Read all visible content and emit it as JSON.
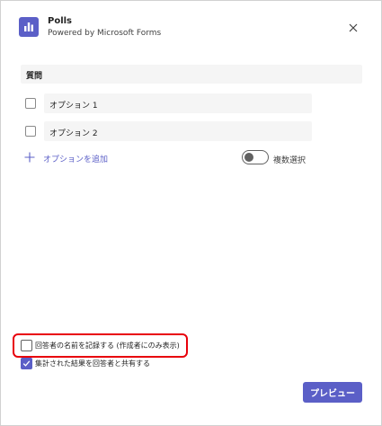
{
  "header": {
    "app_name": "Polls",
    "subtitle": "Powered by Microsoft Forms",
    "icon": "poll-chart-icon",
    "close_icon": "close-icon"
  },
  "question": {
    "placeholder": "質問"
  },
  "options": [
    {
      "label": "オプション 1",
      "checked": false
    },
    {
      "label": "オプション 2",
      "checked": false
    }
  ],
  "add_option": {
    "label": "オプションを追加",
    "icon": "plus-icon"
  },
  "multi_select": {
    "label": "複数選択",
    "enabled": false
  },
  "settings": {
    "record_names": {
      "label": "回答者の名前を記録する (作成者にのみ表示)",
      "checked": false
    },
    "share_results": {
      "label": "集計された結果を回答者と共有する",
      "checked": true
    }
  },
  "footer": {
    "preview_label": "プレビュー"
  },
  "colors": {
    "accent": "#5b5fc7",
    "highlight": "#e8000b"
  }
}
